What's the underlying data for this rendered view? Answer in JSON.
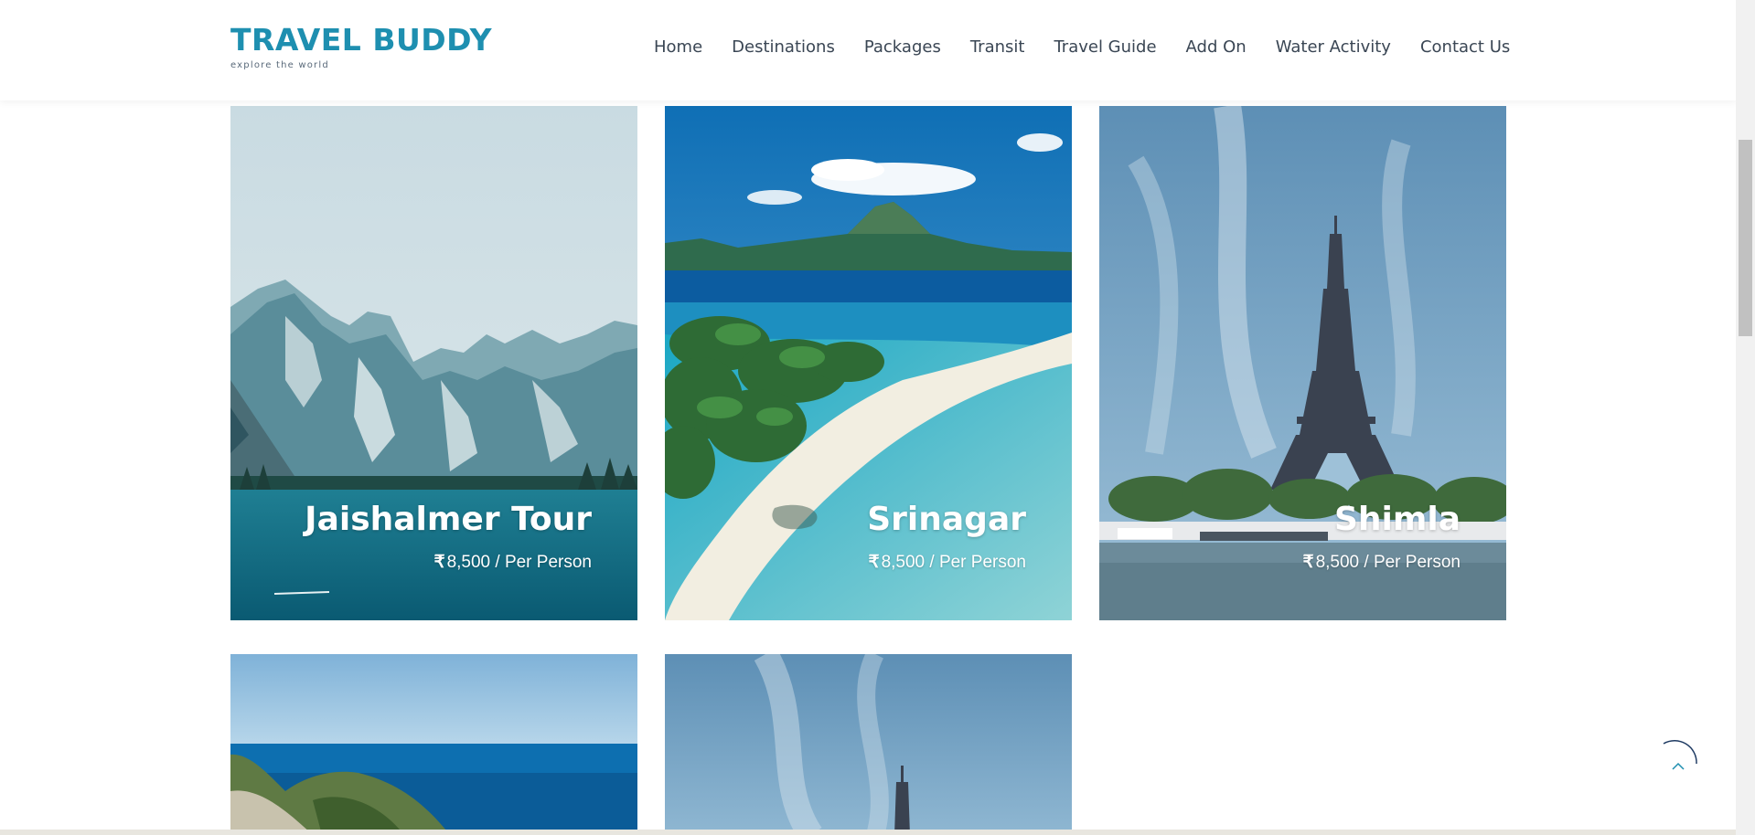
{
  "brand": {
    "title": "TRAVEL BUDDY",
    "tagline": "explore the world",
    "color": "#1e8fb0"
  },
  "nav": {
    "items": [
      {
        "label": "Home"
      },
      {
        "label": "Destinations"
      },
      {
        "label": "Packages"
      },
      {
        "label": "Transit"
      },
      {
        "label": "Travel Guide"
      },
      {
        "label": "Add On"
      },
      {
        "label": "Water Activity"
      },
      {
        "label": "Contact Us"
      }
    ]
  },
  "packages": [
    {
      "name": "Jaishalmer Tour",
      "currency": "₹",
      "price": "8,500 / Per Person",
      "image": "mountain-lake"
    },
    {
      "name": "Srinagar",
      "currency": "₹",
      "price": "8,500 / Per Person",
      "image": "tropical-beach"
    },
    {
      "name": "Shimla",
      "currency": "₹",
      "price": "8,500 / Per Person",
      "image": "eiffel-tower"
    },
    {
      "name": "",
      "currency": "",
      "price": "",
      "image": "sea-cliff"
    },
    {
      "name": "",
      "currency": "",
      "price": "",
      "image": "eiffel-tower"
    }
  ],
  "icons": {
    "back_to_top": "chevron-up-icon"
  }
}
